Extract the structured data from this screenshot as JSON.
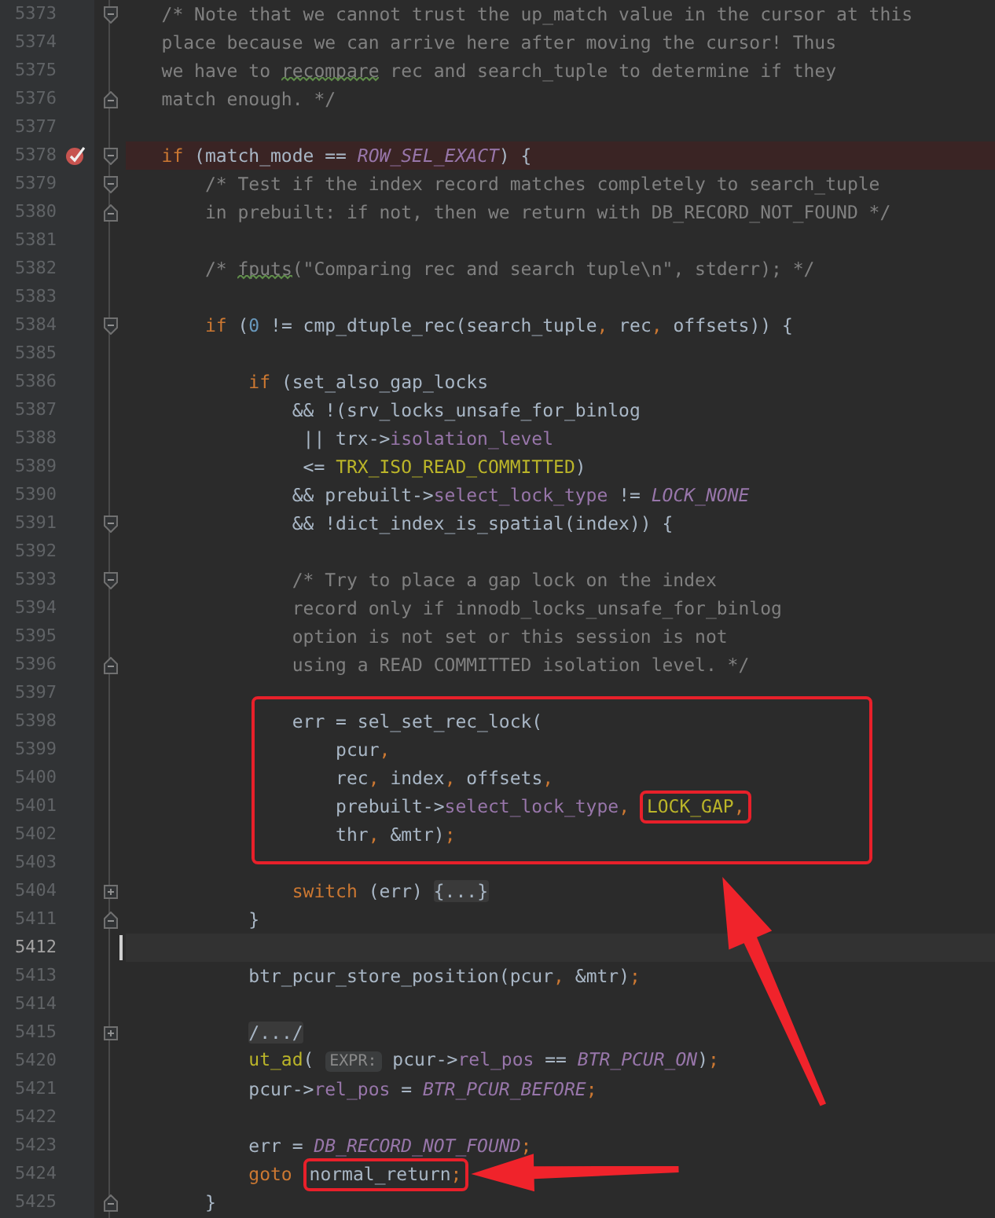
{
  "lines": [
    {
      "number": "5373",
      "fold": {
        "kind": "start"
      },
      "tokens": [
        {
          "kind": "comment",
          "text": "   /* Note that we cannot trust the up_match value in the cursor at this"
        }
      ]
    },
    {
      "number": "5374",
      "tokens": [
        {
          "kind": "comment",
          "text": "   place because we can arrive here after moving the cursor! Thus"
        }
      ]
    },
    {
      "number": "5375",
      "tokens": [
        {
          "kind": "comment",
          "text": "   we have to "
        },
        {
          "kind": "comment",
          "text": "recompare",
          "typo": true
        },
        {
          "kind": "comment",
          "text": " rec and search_tuple to determine if they"
        }
      ]
    },
    {
      "number": "5376",
      "fold": {
        "kind": "end"
      },
      "tokens": [
        {
          "kind": "comment",
          "text": "   match enough. */"
        }
      ]
    },
    {
      "number": "5377"
    },
    {
      "number": "5378",
      "fold": {
        "kind": "start"
      },
      "breakpoint": true,
      "tokens": [
        {
          "kind": "keyword",
          "text": "   if"
        },
        {
          "kind": "plain",
          "text": " (match_mode == "
        },
        {
          "kind": "constant",
          "text": "ROW_SEL_EXACT"
        },
        {
          "kind": "plain",
          "text": ") {"
        }
      ]
    },
    {
      "number": "5379",
      "fold": {
        "kind": "start"
      },
      "tokens": [
        {
          "kind": "comment",
          "text": "       /* Test if the index record matches completely to search_tuple"
        }
      ]
    },
    {
      "number": "5380",
      "fold": {
        "kind": "end"
      },
      "tokens": [
        {
          "kind": "comment",
          "text": "       in prebuilt: if not, then we return with DB_RECORD_NOT_FOUND */"
        }
      ]
    },
    {
      "number": "5381"
    },
    {
      "number": "5382",
      "tokens": [
        {
          "kind": "comment",
          "text": "       /* "
        },
        {
          "kind": "comment",
          "text": "fputs",
          "typo": true
        },
        {
          "kind": "comment",
          "text": "(\"Comparing rec and search tuple\\n\", stderr); */"
        }
      ]
    },
    {
      "number": "5383"
    },
    {
      "number": "5384",
      "fold": {
        "kind": "start"
      },
      "tokens": [
        {
          "kind": "keyword",
          "text": "       if"
        },
        {
          "kind": "plain",
          "text": " ("
        },
        {
          "kind": "number",
          "text": "0"
        },
        {
          "kind": "plain",
          "text": " != cmp_dtuple_rec(search_tuple"
        },
        {
          "kind": "punct",
          "text": ","
        },
        {
          "kind": "plain",
          "text": " rec"
        },
        {
          "kind": "punct",
          "text": ","
        },
        {
          "kind": "plain",
          "text": " offsets)) {"
        }
      ]
    },
    {
      "number": "5385"
    },
    {
      "number": "5386",
      "tokens": [
        {
          "kind": "keyword",
          "text": "           if"
        },
        {
          "kind": "plain",
          "text": " (set_also_gap_locks"
        }
      ]
    },
    {
      "number": "5387",
      "tokens": [
        {
          "kind": "plain",
          "text": "               && !(srv_locks_unsafe_for_binlog"
        }
      ]
    },
    {
      "number": "5388",
      "tokens": [
        {
          "kind": "plain",
          "text": "                || trx->"
        },
        {
          "kind": "field",
          "text": "isolation_level"
        }
      ]
    },
    {
      "number": "5389",
      "tokens": [
        {
          "kind": "plain",
          "text": "                <= "
        },
        {
          "kind": "macro",
          "text": "TRX_ISO_READ_COMMITTED"
        },
        {
          "kind": "plain",
          "text": ")"
        }
      ]
    },
    {
      "number": "5390",
      "tokens": [
        {
          "kind": "plain",
          "text": "               && prebuilt->"
        },
        {
          "kind": "field",
          "text": "select_lock_type"
        },
        {
          "kind": "plain",
          "text": " != "
        },
        {
          "kind": "constant",
          "text": "LOCK_NONE"
        }
      ]
    },
    {
      "number": "5391",
      "fold": {
        "kind": "start"
      },
      "tokens": [
        {
          "kind": "plain",
          "text": "               && !dict_index_is_spatial(index)) {"
        }
      ]
    },
    {
      "number": "5392"
    },
    {
      "number": "5393",
      "fold": {
        "kind": "start"
      },
      "tokens": [
        {
          "kind": "comment",
          "text": "               /* Try to place a gap lock on the index"
        }
      ]
    },
    {
      "number": "5394",
      "tokens": [
        {
          "kind": "comment",
          "text": "               record only if innodb_locks_unsafe_for_binlog"
        }
      ]
    },
    {
      "number": "5395",
      "tokens": [
        {
          "kind": "comment",
          "text": "               option is not set or this session is not"
        }
      ]
    },
    {
      "number": "5396",
      "fold": {
        "kind": "end"
      },
      "tokens": [
        {
          "kind": "comment",
          "text": "               using a READ COMMITTED isolation level. */"
        }
      ]
    },
    {
      "number": "5397"
    },
    {
      "kind": "callout",
      "arrow": {
        "kind": "below"
      },
      "lines": [
        {
          "number": "5398",
          "tokens": [
            {
              "kind": "plain",
              "text": "               err = sel_set_rec_lock("
            }
          ]
        },
        {
          "number": "5399",
          "tokens": [
            {
              "kind": "plain",
              "text": "                   pcur"
            },
            {
              "kind": "punct",
              "text": ","
            }
          ]
        },
        {
          "number": "5400",
          "tokens": [
            {
              "kind": "plain",
              "text": "                   rec"
            },
            {
              "kind": "punct",
              "text": ","
            },
            {
              "kind": "plain",
              "text": " index"
            },
            {
              "kind": "punct",
              "text": ","
            },
            {
              "kind": "plain",
              "text": " offsets"
            },
            {
              "kind": "punct",
              "text": ","
            }
          ]
        },
        {
          "number": "5401",
          "tokens": [
            {
              "kind": "plain",
              "text": "                   prebuilt->"
            },
            {
              "kind": "field",
              "text": "select_lock_type"
            },
            {
              "kind": "punct",
              "text": ", "
            },
            {
              "kind": "callout",
              "tokens": [
                {
                  "kind": "macro",
                  "text": "LOCK_GAP"
                },
                {
                  "kind": "punct",
                  "text": ","
                }
              ]
            }
          ]
        },
        {
          "number": "5402",
          "tokens": [
            {
              "kind": "plain",
              "text": "                   thr"
            },
            {
              "kind": "punct",
              "text": ","
            },
            {
              "kind": "plain",
              "text": " &mtr)"
            },
            {
              "kind": "punct",
              "text": ";"
            }
          ]
        },
        {
          "number": "5403"
        }
      ]
    },
    {
      "number": "5404",
      "fold": {
        "kind": "collapsed"
      },
      "tokens": [
        {
          "kind": "keyword",
          "text": "               switch"
        },
        {
          "kind": "plain",
          "text": " (err) "
        },
        {
          "kind": "folded",
          "text": "{...}"
        }
      ]
    },
    {
      "number": "5411",
      "fold": {
        "kind": "end"
      },
      "tokens": [
        {
          "kind": "plain",
          "text": "           }"
        }
      ]
    },
    {
      "number": "5412",
      "current": true
    },
    {
      "number": "5413",
      "tokens": [
        {
          "kind": "plain",
          "text": "           btr_pcur_store_position(pcur"
        },
        {
          "kind": "punct",
          "text": ","
        },
        {
          "kind": "plain",
          "text": " &mtr)"
        },
        {
          "kind": "punct",
          "text": ";"
        }
      ]
    },
    {
      "number": "5414"
    },
    {
      "number": "5415",
      "fold": {
        "kind": "collapsed"
      },
      "tokens": [
        {
          "kind": "folded",
          "text": "           /.../"
        }
      ]
    },
    {
      "number": "5420",
      "tokens": [
        {
          "kind": "macro",
          "text": "           ut_ad"
        },
        {
          "kind": "plain",
          "text": "( "
        },
        {
          "kind": "hint",
          "text": "EXPR:"
        },
        {
          "kind": "plain",
          "text": " pcur->"
        },
        {
          "kind": "field",
          "text": "rel_pos"
        },
        {
          "kind": "plain",
          "text": " == "
        },
        {
          "kind": "constant",
          "text": "BTR_PCUR_ON"
        },
        {
          "kind": "plain",
          "text": ")"
        },
        {
          "kind": "punct",
          "text": ";"
        }
      ]
    },
    {
      "number": "5421",
      "tokens": [
        {
          "kind": "plain",
          "text": "           pcur->"
        },
        {
          "kind": "field",
          "text": "rel_pos"
        },
        {
          "kind": "plain",
          "text": " = "
        },
        {
          "kind": "constant",
          "text": "BTR_PCUR_BEFORE"
        },
        {
          "kind": "punct",
          "text": ";"
        }
      ]
    },
    {
      "number": "5422"
    },
    {
      "number": "5423",
      "tokens": [
        {
          "kind": "plain",
          "text": "           err = "
        },
        {
          "kind": "constant",
          "text": "DB_RECORD_NOT_FOUND"
        },
        {
          "kind": "punct",
          "text": ";"
        }
      ]
    },
    {
      "number": "5424",
      "tokens": [
        {
          "kind": "keyword",
          "text": "           goto "
        },
        {
          "kind": "callout",
          "arrow": {
            "kind": "right"
          },
          "tokens": [
            {
              "kind": "plain",
              "text": "normal_return"
            },
            {
              "kind": "punct",
              "text": ";"
            }
          ]
        }
      ]
    },
    {
      "number": "5425",
      "fold": {
        "kind": "end"
      },
      "tokens": [
        {
          "kind": "plain",
          "text": "       }"
        }
      ]
    }
  ]
}
